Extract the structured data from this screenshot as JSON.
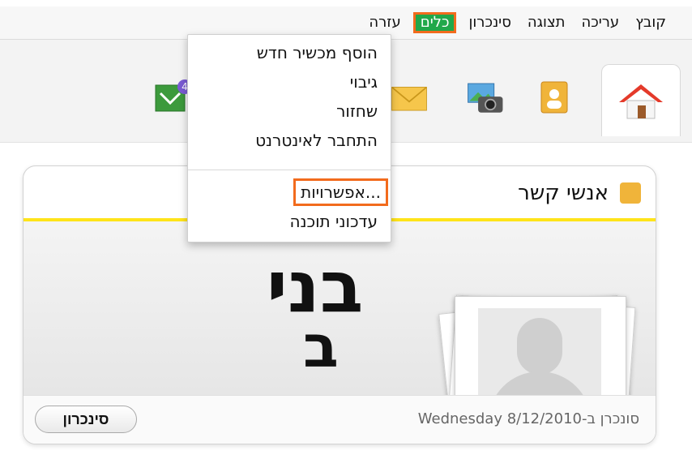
{
  "menubar": {
    "items": [
      {
        "label": "קובץ"
      },
      {
        "label": "עריכה"
      },
      {
        "label": "תצוגה"
      },
      {
        "label": "סינכרון"
      },
      {
        "label": "כלים",
        "active": true
      },
      {
        "label": "עזרה"
      }
    ]
  },
  "toolbar": {
    "icons": [
      "home-icon",
      "contacts-icon",
      "photos-icon",
      "mail-icon",
      "sms-icon"
    ],
    "sms_badge": "4"
  },
  "dropdown": {
    "items": [
      {
        "label": "הוסף מכשיר חדש"
      },
      {
        "label": "גיבוי"
      },
      {
        "label": "שחזור"
      },
      {
        "label": "התחבר לאינטרנט"
      },
      {
        "label": "אפשרויות...",
        "highlighted": true
      },
      {
        "label": "עדכוני תוכנה"
      }
    ]
  },
  "panel": {
    "title": "אנשי קשר",
    "contact_name_line1": "בני",
    "contact_name_line2": "ב",
    "sync_status": "סונכרן ב-Wednesday 8/12/2010",
    "sync_button": "סינכרון"
  },
  "colors": {
    "accent_green": "#21a84a",
    "highlight_orange": "#f26b1d",
    "header_line_yellow": "#ffe41a"
  }
}
